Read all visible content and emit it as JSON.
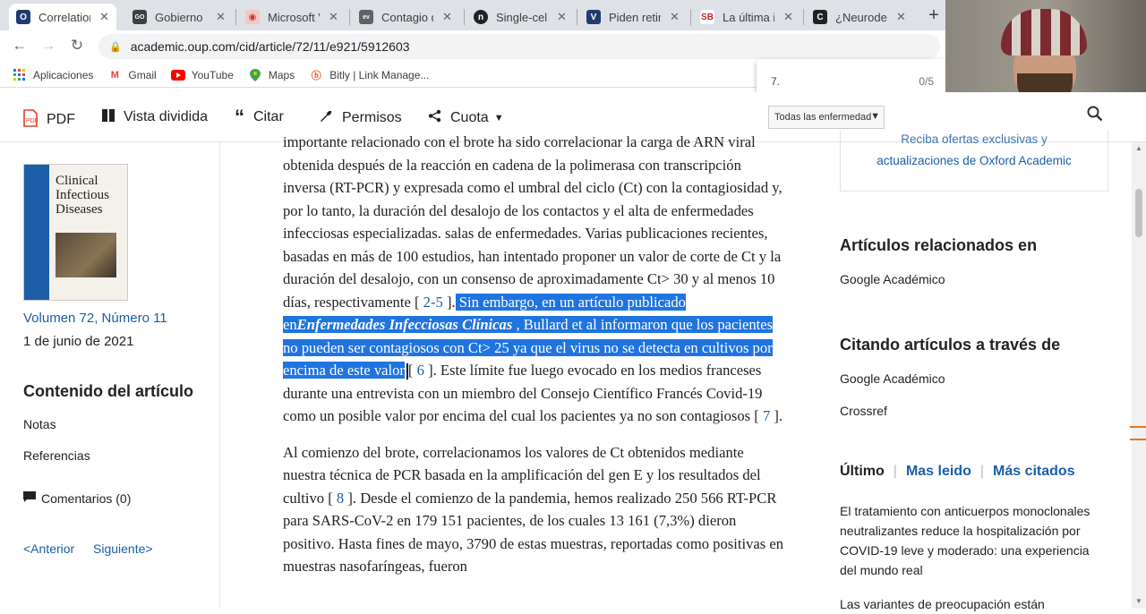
{
  "tabs": [
    {
      "title": "Correlation",
      "favicon": "O",
      "color": "#1f3c6e",
      "active": true
    },
    {
      "title": "Gobierno in",
      "favicon": "GO",
      "color": "#3c4043",
      "active": false
    },
    {
      "title": "Microsoft V",
      "favicon": "ms",
      "color": "#e8a0a0",
      "active": false
    },
    {
      "title": "Contagio de",
      "favicon": "ev",
      "color": "#5f6368",
      "active": false
    },
    {
      "title": "Single-cell",
      "favicon": "n",
      "color": "#202124",
      "active": false
    },
    {
      "title": "Piden retire",
      "favicon": "V",
      "color": "#1f3c6e",
      "active": false
    },
    {
      "title": "La última in",
      "favicon": "SB",
      "color": "#c62828",
      "active": false
    },
    {
      "title": "¿Neuroderm",
      "favicon": "C",
      "color": "#202124",
      "active": false
    }
  ],
  "address": {
    "url": "academic.oup.com/cid/article/72/11/e921/5912603"
  },
  "bookmarks": [
    {
      "label": "Aplicaciones",
      "icon": "apps-icon"
    },
    {
      "label": "Gmail",
      "icon": "gmail-icon"
    },
    {
      "label": "YouTube",
      "icon": "youtube-icon"
    },
    {
      "label": "Maps",
      "icon": "maps-icon"
    },
    {
      "label": "Bitly | Link Manage...",
      "icon": "bitly-icon"
    }
  ],
  "find": {
    "query": "7.",
    "count": "0/5"
  },
  "toolbar": {
    "pdf": "PDF",
    "split": "Vista dividida",
    "cite": "Citar",
    "permissions": "Permisos",
    "share": "Cuota",
    "filter_value": "Todas las enfermedad"
  },
  "sidebar": {
    "journal_title": "Clinical Infectious Diseases",
    "volume": "Volumen 72, Número 11",
    "date": "1 de junio de 2021",
    "contents_title": "Contenido del artículo",
    "notes": "Notas",
    "references": "Referencias",
    "comments": "Comentarios (0)",
    "prev": "<Anterior",
    "next": "Siguiente>"
  },
  "article": {
    "p1_start": "importante relacionado con el brote ha sido correlacionar la carga de ARN viral obtenida después de la reacción en cadena de la polimerasa con transcripción inversa (RT-PCR) y expresada como el umbral del ciclo (Ct) con la contagiosidad y, por lo tanto, la duración del desalojo de los contactos y el alta de enfermedades infecciosas especializadas. salas de enfermedades. Varias publicaciones recientes, basadas en más de 100 estudios, han intentado proponer un valor de corte de Ct y la duración del desalojo, con un consenso de aproximadamente Ct> 30 y al menos 10 días, respectivamente [",
    "ref_2_5": "2-5",
    "p1_after_ref": "].",
    "hl_1": "Sin embargo, en un artículo publicado en",
    "hl_journal": "Enfermedades Infecciosas Clínicas",
    "hl_2": ", Bullard et al informaron que los pacientes no pueden ser contagiosos con Ct> 25 ya que el virus no se detecta en cultivos por encima de este valor",
    "p1_open6": "[",
    "ref_6": "6",
    "p1_rest": "]. Este límite fue luego evocado en los medios franceses durante una entrevista con un miembro del Consejo Científico Francés Covid-19 como un posible valor por encima del cual los pacientes ya no son contagiosos [",
    "ref_7": "7",
    "p1_end": "].",
    "p2_start": "Al comienzo del brote, correlacionamos los valores de Ct obtenidos mediante nuestra técnica de PCR basada en la amplificación del gen E y los resultados del cultivo [",
    "ref_8": "8",
    "p2_rest": "]. Desde el comienzo de la pandemia, hemos realizado 250 566 RT-PCR para SARS-CoV-2 en 179 151 pacientes, de los cuales 13 161 (7,3%) dieron positivo. Hasta fines de mayo, 3790 de estas muestras, reportadas como positivas en muestras nasofaríngeas, fueron"
  },
  "right": {
    "promo_1": "Reciba ofertas exclusivas y",
    "promo_2": "actualizaciones de Oxford Academic",
    "related_title": "Artículos relacionados en",
    "related_link": "Google Académico",
    "citing_title": "Citando artículos a través de",
    "citing_link_1": "Google Académico",
    "citing_link_2": "Crossref",
    "tab_latest": "Último",
    "tab_most_read": "Mas leido",
    "tab_most_cited": "Más citados",
    "latest_1": "El tratamiento con anticuerpos monoclonales neutralizantes reduce la hospitalización por COVID-19 leve y moderado: una experiencia del mundo real",
    "latest_2": "Las variantes de preocupación están"
  }
}
